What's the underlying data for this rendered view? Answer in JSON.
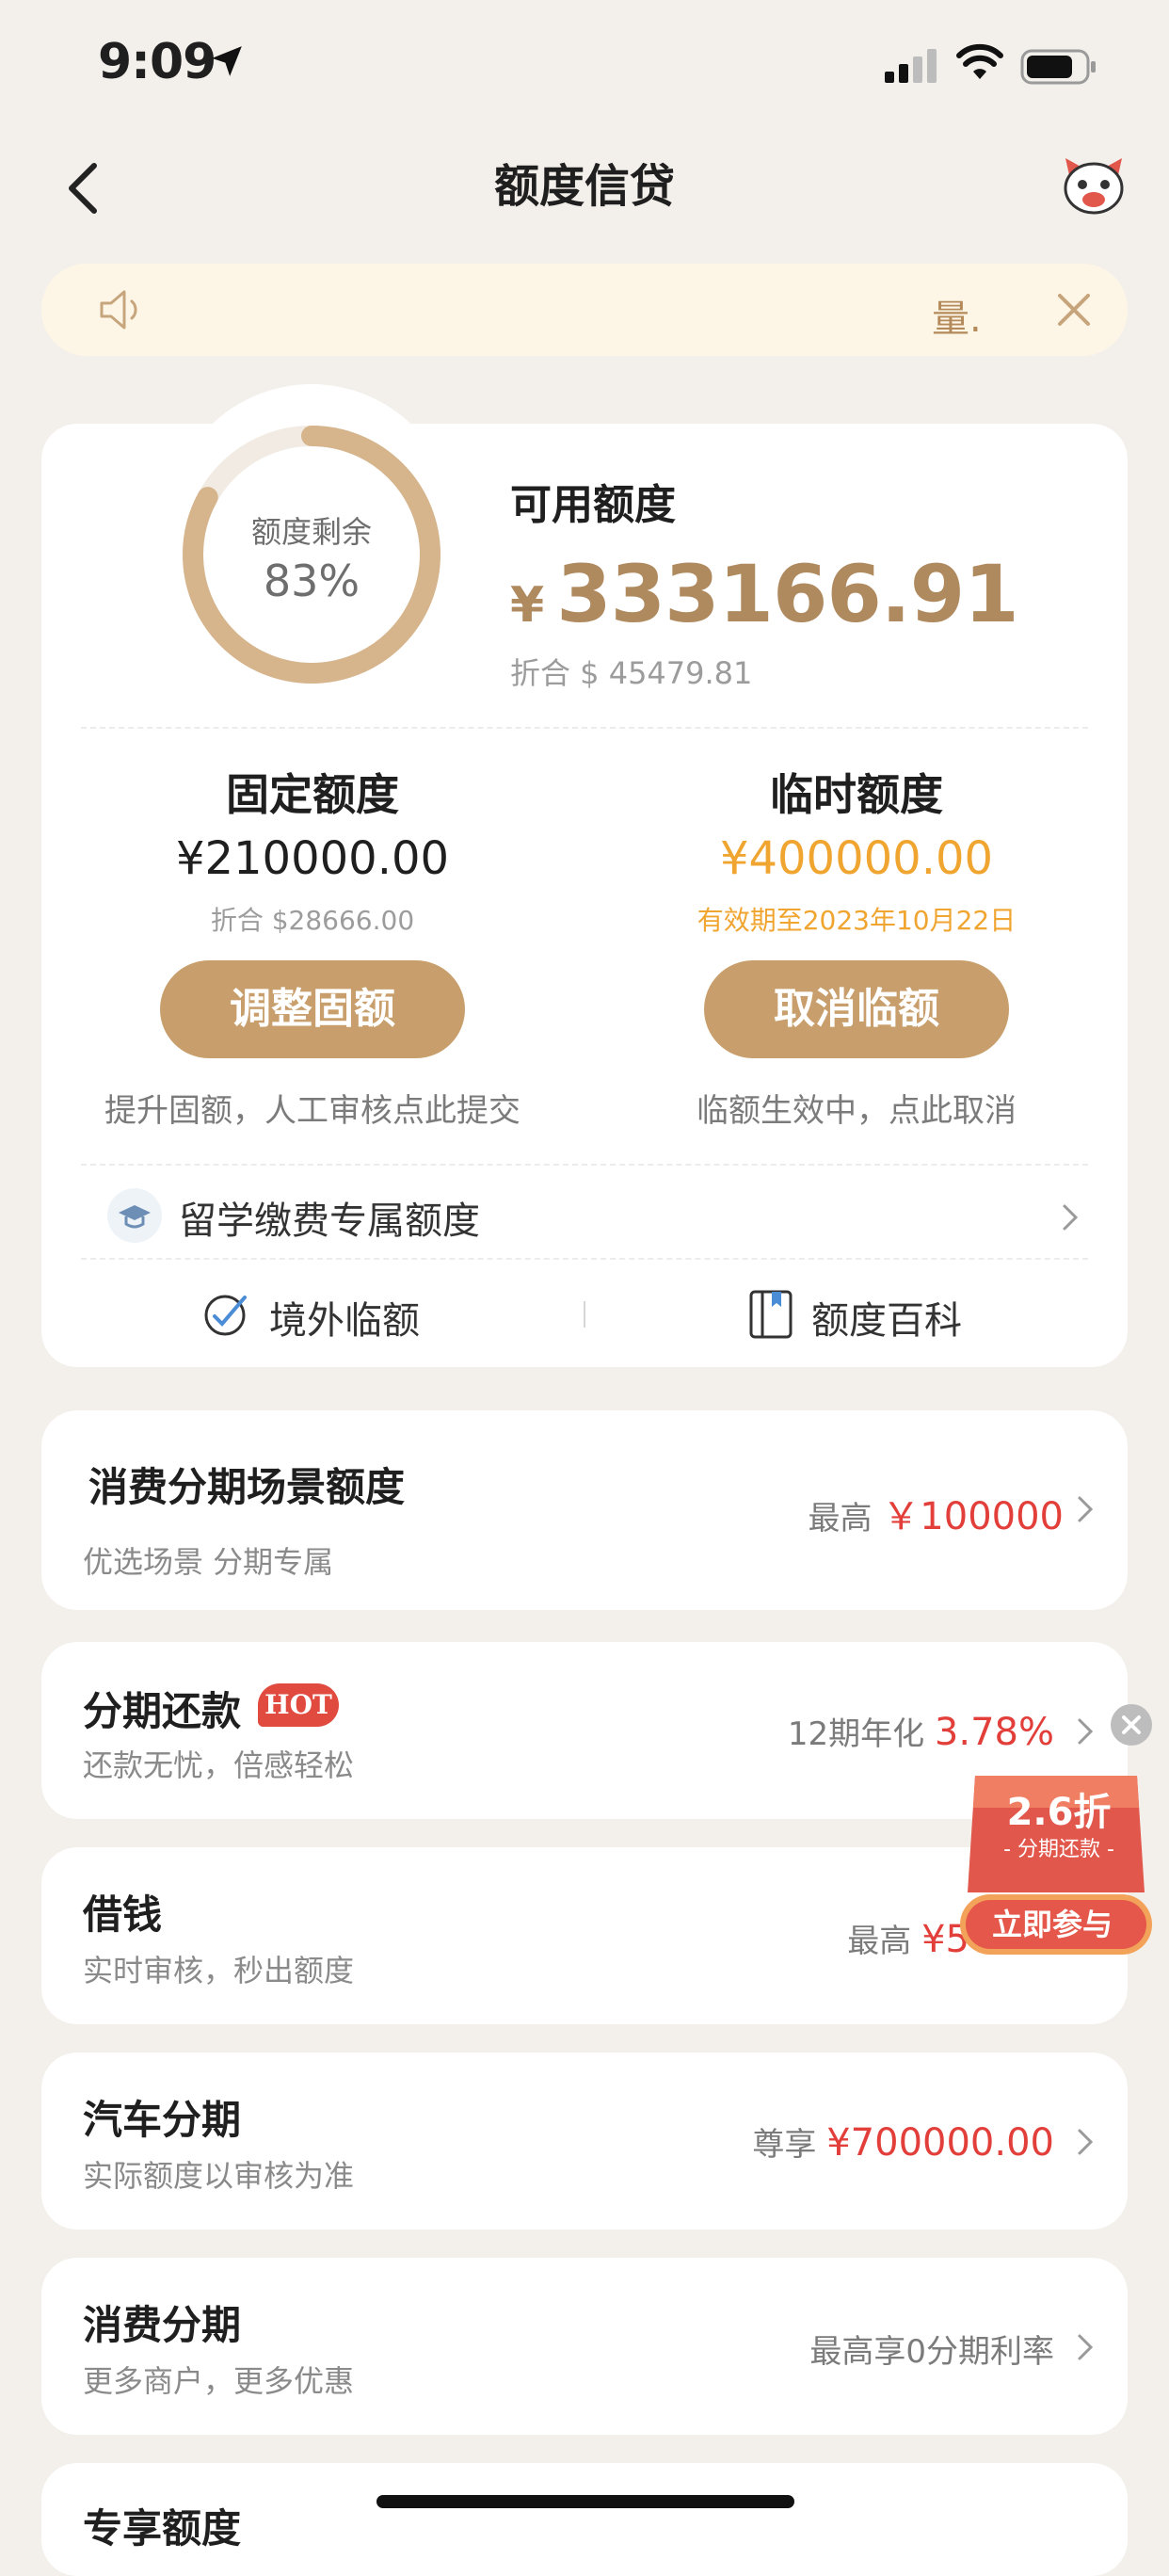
{
  "status": {
    "time": "9:09"
  },
  "nav": {
    "title": "额度信贷"
  },
  "notice": {
    "text": "量."
  },
  "credit": {
    "ring_label": "额度剩余",
    "ring_value": "83%",
    "ring_fraction": 0.83,
    "available_title": "可用额度",
    "currency_symbol": "¥",
    "available_amount": "333166.91",
    "available_converted": "折合 $ 45479.81",
    "fixed_title": "固定额度",
    "fixed_amount": "¥210000.00",
    "fixed_converted": "折合 $28666.00",
    "fixed_button": "调整固额",
    "fixed_note": "提升固额，人工审核点此提交",
    "temp_title": "临时额度",
    "temp_amount": "¥400000.00",
    "temp_valid": "有效期至2023年10月22日",
    "temp_button": "取消临额",
    "temp_note": "临额生效中，点此取消",
    "study_label": "留学缴费专属额度",
    "overseas_label": "境外临额",
    "encyclopedia_label": "额度百科"
  },
  "list": [
    {
      "title": "消费分期场景额度",
      "subtitle": "优选场景 分期专属",
      "right_prefix": "最高",
      "right_value": "￥100000"
    },
    {
      "title": "分期还款",
      "badge": "HOT",
      "subtitle": "还款无忧，倍感轻松",
      "right_prefix": "12期年化",
      "right_value": "3.78%"
    },
    {
      "title": "借钱",
      "subtitle": "实时审核，秒出额度",
      "right_prefix": "最高",
      "right_value": "¥5"
    },
    {
      "title": "汽车分期",
      "subtitle": "实际额度以审核为准",
      "right_prefix": "尊享",
      "right_value": "¥700000.00"
    },
    {
      "title": "消费分期",
      "subtitle": "更多商户，更多优惠",
      "right_prefix": "最高享0分期利率",
      "right_value": ""
    },
    {
      "title": "专享额度",
      "subtitle": "",
      "right_prefix": "",
      "right_value": ""
    }
  ],
  "promo": {
    "discount": "2.6折",
    "subtitle": "- 分期还款 -",
    "button": "立即参与"
  },
  "colors": {
    "accent": "#c89f6c",
    "gold_text": "#b08a5f",
    "temp_yellow": "#f0a530",
    "red": "#e23e3a",
    "background": "#f3efea"
  }
}
